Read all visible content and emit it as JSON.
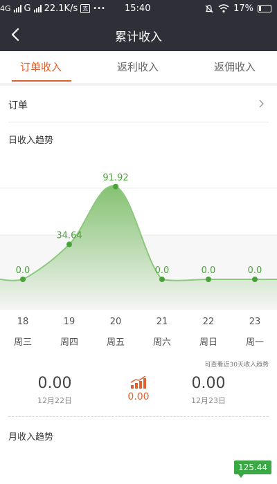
{
  "status_bar": {
    "network_left": "4G",
    "network_right": "G",
    "speed": "22.1K/s",
    "more": "•••",
    "time": "15:40",
    "battery": "17%"
  },
  "nav": {
    "title": "累计收入"
  },
  "tabs": [
    {
      "label": "订单收入",
      "active": true
    },
    {
      "label": "返利收入",
      "active": false
    },
    {
      "label": "返佣收入",
      "active": false
    }
  ],
  "order_row": {
    "label": "订单"
  },
  "daily_trend_title": "日收入趋势",
  "chart_data": {
    "type": "area",
    "categories": [
      "18",
      "19",
      "20",
      "21",
      "22",
      "23"
    ],
    "weekdays": [
      "周三",
      "周四",
      "周五",
      "周六",
      "周日",
      "周一"
    ],
    "values": [
      0.0,
      34.64,
      91.92,
      0.0,
      0.0,
      0.0
    ],
    "value_labels": [
      "0.0",
      "34.64",
      "91.92",
      "0.0",
      "0.0",
      "0.0"
    ],
    "ylim": [
      0,
      100
    ],
    "grid": true,
    "colors": {
      "line": "#8cc97e",
      "point": "#4aa33a",
      "label": "#4aa33a",
      "fill_top": "#7fbf6b",
      "fill_bottom": "#f5f5f5"
    }
  },
  "hint_text": "可查看近30天收入趋势",
  "summary": {
    "left": {
      "value": "0.00",
      "date": "12月22日"
    },
    "middle": {
      "value": "0.00"
    },
    "right": {
      "value": "0.00",
      "date": "12月23日"
    }
  },
  "monthly_trend_title": "月收入趋势",
  "monthly_badge": "125.44",
  "accent_color": "#e0612d"
}
